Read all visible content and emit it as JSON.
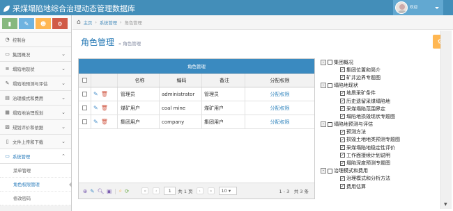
{
  "app": {
    "title": "采煤塌陷地综合治理动态管理数据库",
    "user_greeting": "欢迎"
  },
  "colors": {
    "topbar": "#438eb9",
    "accent": "#2b7dbc",
    "grid_header": "#3a8ac0",
    "orange": "#ffb752"
  },
  "shortcuts": [
    {
      "icon": "signal-icon",
      "color": "#87b87f",
      "glyph": "▮"
    },
    {
      "icon": "pencil-icon",
      "color": "#6fb3e0",
      "glyph": "✎"
    },
    {
      "icon": "group-icon",
      "color": "#ffb752",
      "glyph": "☻"
    },
    {
      "icon": "cogs-icon",
      "color": "#d15b47",
      "glyph": "⚙"
    }
  ],
  "sidebar": {
    "items": [
      {
        "label": "控制台",
        "icon": "tachometer-icon",
        "has_children": false
      },
      {
        "label": "集团概况",
        "icon": "desktop-icon",
        "has_children": true
      },
      {
        "label": "塌陷地现状",
        "icon": "list-icon",
        "has_children": true
      },
      {
        "label": "塌陷地预测与评估",
        "icon": "edit-icon",
        "has_children": true
      },
      {
        "label": "治理模式和费用",
        "icon": "list-alt-icon",
        "has_children": true
      },
      {
        "label": "塌陷地治理规划",
        "icon": "calendar-icon",
        "has_children": true
      },
      {
        "label": "规划评价和依据",
        "icon": "picture-icon",
        "has_children": true
      },
      {
        "label": "文件上传和下载",
        "icon": "file-icon",
        "has_children": true
      },
      {
        "label": "系统管理",
        "icon": "desktop-icon",
        "has_children": true
      }
    ],
    "sub_items": [
      {
        "label": "菜单管理"
      },
      {
        "label": "角色权限管理"
      },
      {
        "label": "修改密码"
      }
    ]
  },
  "breadcrumb": {
    "home": "主页",
    "section": "系统管理",
    "current": "角色管理"
  },
  "page": {
    "title": "角色管理",
    "subtitle": "角色管理"
  },
  "grid": {
    "caption": "角色管理",
    "columns": [
      "名称",
      "编码",
      "备注",
      "分配权限"
    ],
    "rows": [
      {
        "name": "管理员",
        "code": "administrator",
        "remark": "管理员",
        "action": "分配权限"
      },
      {
        "name": "煤矿用户",
        "code": "coal mine",
        "remark": "煤矿用户",
        "action": "分配权限"
      },
      {
        "name": "集团用户",
        "code": "company",
        "remark": "集团用户",
        "action": "分配权限"
      }
    ],
    "pager": {
      "page": "1",
      "total_pages_text": "共 1 页",
      "page_size": "10",
      "record_info": "1 - 3　共 3 条"
    }
  },
  "tree": [
    {
      "label": "集团概况",
      "children": [
        "集团位置和简介",
        "矿井边界专题图"
      ]
    },
    {
      "label": "塌陷地现状",
      "children": [
        "地质采矿条件",
        "历史遗留采煤塌陷地",
        "采煤塌陷范围界定",
        "塌陷地损毁现状专题图"
      ]
    },
    {
      "label": "塌陷地预测与评估",
      "children": [
        "预测方法",
        "损毁土地地类预测专题图",
        "采煤塌陷地稳定性评价",
        "工作面接续计划说明",
        "塌陷深度预测专题图"
      ]
    },
    {
      "label": "治理模式和费用",
      "children": [
        "治理模式和分析方法",
        "费用估算"
      ]
    }
  ]
}
